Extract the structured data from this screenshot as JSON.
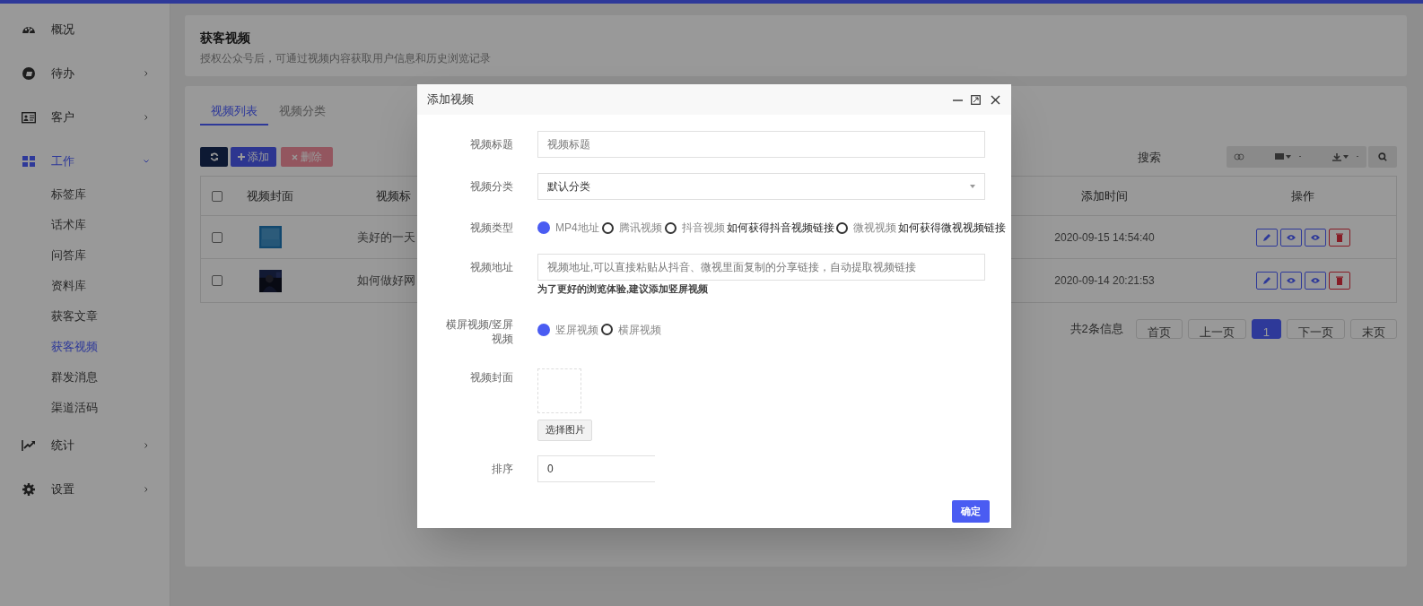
{
  "sidebar": {
    "items": [
      {
        "label": "概况",
        "kind": "link"
      },
      {
        "label": "待办",
        "kind": "group",
        "expanded": false
      },
      {
        "label": "客户",
        "kind": "group",
        "expanded": false
      },
      {
        "label": "工作",
        "kind": "group",
        "expanded": true,
        "children": [
          {
            "label": "标签库",
            "selected": false
          },
          {
            "label": "话术库",
            "selected": false
          },
          {
            "label": "问答库",
            "selected": false
          },
          {
            "label": "资料库",
            "selected": false
          },
          {
            "label": "获客文章",
            "selected": false
          },
          {
            "label": "获客视频",
            "selected": true
          },
          {
            "label": "群发消息",
            "selected": false
          },
          {
            "label": "渠道活码",
            "selected": false
          }
        ]
      },
      {
        "label": "统计",
        "kind": "group",
        "expanded": false
      },
      {
        "label": "设置",
        "kind": "group",
        "expanded": false
      }
    ]
  },
  "header": {
    "title": "获客视频",
    "subtitle": "授权公众号后，可通过视频内容获取用户信息和历史浏览记录"
  },
  "tabs": [
    {
      "label": "视频列表",
      "selected": true
    },
    {
      "label": "视频分类",
      "selected": false
    }
  ],
  "toolbar": {
    "add": "添加",
    "delete": "删除",
    "search": {
      "placeholder": "搜索"
    }
  },
  "table": {
    "header_checked": false,
    "columns": [
      "视频封面",
      "视频标",
      "添加时间",
      "操作"
    ],
    "rows": [
      {
        "checked": false,
        "title": "美好的一天",
        "time": "2020-09-15 14:54:40"
      },
      {
        "checked": false,
        "title": "如何做好网",
        "time": "2020-09-14 20:21:53"
      }
    ]
  },
  "pagination": {
    "summary": "共2条信息",
    "pages": [
      {
        "label": "首页",
        "selected": false
      },
      {
        "label": "上一页",
        "selected": false
      },
      {
        "label": "1",
        "selected": true
      },
      {
        "label": "下一页",
        "selected": false
      },
      {
        "label": "末页",
        "selected": false
      }
    ]
  },
  "dialog": {
    "title": "添加视频",
    "fields": [
      {
        "kind": "input",
        "label": "视频标题",
        "placeholder": "视频标题"
      },
      {
        "kind": "select",
        "label": "视频分类",
        "value": "默认分类"
      },
      {
        "kind": "radio",
        "label": "视频类型",
        "options": [
          {
            "label": "MP4地址",
            "selected": true
          },
          {
            "label": "腾讯视频",
            "selected": false
          },
          {
            "label": "抖音视频",
            "selected": false,
            "help_link": "如何获得抖音视频链接"
          },
          {
            "label": "微视视频",
            "selected": false,
            "help_link": "如何获得微视视频链接"
          }
        ]
      },
      {
        "kind": "input",
        "label": "视频地址",
        "placeholder": "视频地址,可以直接粘贴从抖音、微视里面复制的分享链接，自动提取视频链接",
        "hint": "为了更好的浏览体验,建议添加竖屏视频"
      },
      {
        "kind": "radio",
        "label": "横屏视频/竖屏视频",
        "options": [
          {
            "label": "竖屏视频",
            "selected": true
          },
          {
            "label": "横屏视频",
            "selected": false
          }
        ]
      },
      {
        "label": "视频封面",
        "button": "选择图片"
      },
      {
        "kind": "short_input",
        "label": "排序",
        "value": "0"
      }
    ],
    "confirm": "确定"
  }
}
